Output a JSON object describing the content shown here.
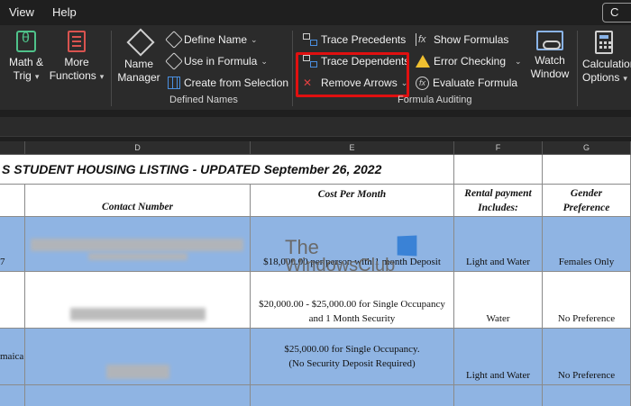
{
  "menubar": {
    "items": [
      "View",
      "Help"
    ],
    "corner_text": "C"
  },
  "ribbon": {
    "math_trig": {
      "line1": "Math &",
      "line2": "Trig",
      "chevron": "▾"
    },
    "more_functions": {
      "line1": "More",
      "line2": "Functions",
      "chevron": "▾"
    },
    "name_manager": {
      "line1": "Name",
      "line2": "Manager"
    },
    "define_name": "Define Name",
    "use_in_formula": "Use in Formula",
    "create_from_selection": "Create from Selection",
    "defined_names_label": "Defined Names",
    "trace_precedents": "Trace Precedents",
    "trace_dependents": "Trace Dependents",
    "remove_arrows": "Remove Arrows",
    "show_formulas": "Show Formulas",
    "error_checking": "Error Checking",
    "evaluate_formula": "Evaluate Formula",
    "formula_auditing_label": "Formula Auditing",
    "watch_window": {
      "line1": "Watch",
      "line2": "Window"
    },
    "calculation_options": {
      "line1": "Calculation",
      "line2": "Options"
    },
    "chevron": "⌄"
  },
  "columns": [
    "D",
    "E",
    "F",
    "G"
  ],
  "sheet": {
    "title": "S STUDENT HOUSING LISTING - UPDATED September 26, 2022",
    "headers": {
      "contact": "Contact Number",
      "cost": "Cost Per Month",
      "rental_line1": "Rental payment",
      "rental_line2": "Includes:",
      "gender_line1": "Gender",
      "gender_line2": "Preference"
    },
    "rows": [
      {
        "a": "7",
        "cost1": "$18,000.00 per person with 1 month Deposit",
        "cost2": "",
        "rental": "Light and Water",
        "gender": "Females Only"
      },
      {
        "a": "",
        "cost1": "$20,000.00 - $25,000.00 for Single Occupancy",
        "cost2": "and 1 Month Security",
        "rental": "Water",
        "gender": "No Preference"
      },
      {
        "a": "maica",
        "cost1": "$25,000.00 for Single Occupancy.",
        "cost2": "(No Security Deposit Required)",
        "rental": "Light and Water",
        "gender": "No Preference"
      }
    ]
  },
  "watermark": {
    "line1": "The",
    "line2": "WindowsClub"
  }
}
